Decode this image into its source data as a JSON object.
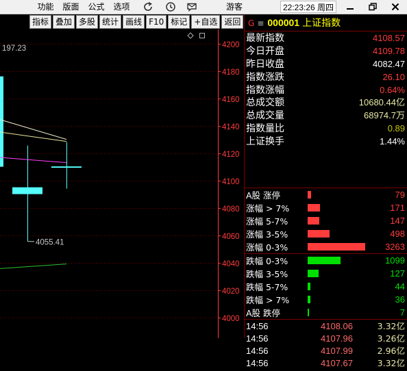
{
  "title_bar": {
    "menu": [
      "功能",
      "版面",
      "公式",
      "选项"
    ],
    "guest_label": "游客",
    "clock": "22:23:26 周四"
  },
  "toolbar": [
    "指标",
    "叠加",
    "多股",
    "统计",
    "画线",
    "F10",
    "标记",
    "+自选",
    "返回"
  ],
  "quote": {
    "prefix_glyph": "G",
    "menu_glyph": "≡",
    "code": "000001",
    "name": "上证指数",
    "stats": [
      {
        "label": "最新指数",
        "value": "4108.57",
        "color": "#ff3c3c"
      },
      {
        "label": "今日开盘",
        "value": "4109.78",
        "color": "#ff3c3c"
      },
      {
        "label": "昨日收盘",
        "value": "4082.47",
        "color": "#ffffff"
      },
      {
        "label": "指数涨跌",
        "value": "26.10",
        "color": "#ff3c3c"
      },
      {
        "label": "指数涨幅",
        "value": "0.64%",
        "color": "#ff3c3c"
      },
      {
        "label": "总成交额",
        "value": "10680.44亿",
        "color": "#e8e8a8"
      },
      {
        "label": "总成交量",
        "value": "68974.7万",
        "color": "#e8e8a8"
      },
      {
        "label": "指数量比",
        "value": "0.89",
        "color": "#c8c800"
      },
      {
        "label": "上证换手",
        "value": "1.44%",
        "color": "#ffffff"
      }
    ],
    "trades": [
      {
        "time": "14:56",
        "price": "4108.06",
        "volume": "3.32亿"
      },
      {
        "time": "14:56",
        "price": "4107.96",
        "volume": "3.26亿"
      },
      {
        "time": "14:56",
        "price": "4107.99",
        "volume": "2.96亿"
      },
      {
        "time": "14:56",
        "price": "4107.67",
        "volume": "3.32亿"
      }
    ]
  },
  "chart_data": [
    {
      "type": "candlestick",
      "high_label": "197.23",
      "low_label": "4055.41",
      "y_ticks": [
        "4200",
        "4180",
        "4160",
        "4140",
        "4120",
        "4100",
        "4080",
        "4060",
        "4040",
        "4020",
        "4000"
      ],
      "ylim": [
        4000,
        4200
      ],
      "grid": true,
      "candles": [
        {
          "index": -1,
          "open": 4176,
          "close": 4110,
          "high": 4197.23,
          "low": 4110
        },
        {
          "index": 0,
          "open": 4095,
          "close": 4090,
          "high": 4125.5,
          "low": 4055.41
        },
        {
          "index": 1,
          "open": 4110,
          "close": 4110,
          "high": 4128,
          "low": 4094
        }
      ],
      "lines": [
        {
          "color": "#e8e8c8",
          "points": [
            [
              -1,
              4147
            ],
            [
              1,
              4130
            ]
          ]
        },
        {
          "color": "#e8e8a0",
          "points": [
            [
              -1,
              4136.5
            ],
            [
              1,
              4128.5
            ]
          ]
        },
        {
          "color": "#ff40ff",
          "points": [
            [
              -1,
              4117.5
            ],
            [
              1,
              4113
            ]
          ]
        },
        {
          "color": "#30c030",
          "points": [
            [
              -1,
              4035
            ],
            [
              1,
              4039
            ]
          ]
        }
      ]
    },
    {
      "type": "bar",
      "categories": [
        "A股 涨停",
        "涨幅 > 7%",
        "涨幅 5-7%",
        "涨幅 3-5%",
        "涨幅 0-3%",
        "跌幅 0-3%",
        "跌幅 3-5%",
        "跌幅 5-7%",
        "跌幅 > 7%",
        "A股 跌停"
      ],
      "values": [
        79,
        171,
        147,
        498,
        3263,
        1099,
        127,
        44,
        36,
        7
      ],
      "groups": [
        "up",
        "up",
        "up",
        "up",
        "up",
        "down",
        "down",
        "down",
        "down",
        "down"
      ]
    }
  ],
  "colors": {
    "up": "#ff3c3c",
    "down": "#00e000",
    "candle": "#54fcfc",
    "axis": "#ff3c3c",
    "grid": "#800000",
    "title": "#ffff00",
    "trade_price": "#ff6a6a",
    "trade_volume": "#e8e8a8"
  }
}
